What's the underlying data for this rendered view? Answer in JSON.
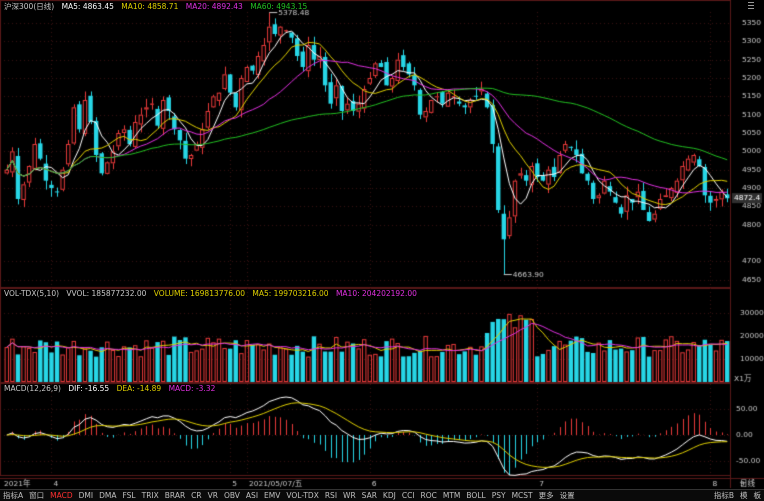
{
  "colors": {
    "up": "#e83a3a",
    "down": "#27d6e6",
    "ma5": "#ffffff",
    "ma10": "#e0d000",
    "ma20": "#e030e0",
    "ma60": "#22c022",
    "text": "#c8c8c8",
    "grid": "#3a1010",
    "axis": "#5a1818"
  },
  "price_info": {
    "name": "沪深300(日线)",
    "ma5": "MA5: 4863.45",
    "ma10": "MA10: 4858.71",
    "ma20": "MA20: 4892.43",
    "ma60": "MA60: 4943.15"
  },
  "volume_info": {
    "name": "VOL-TDX(5,10)",
    "vvol": "VVOL: 185877232.00",
    "volume": "VOLUME: 169813776.00",
    "ma5": "MA5: 199703216.00",
    "ma10": "MA10: 204202192.00"
  },
  "macd_info": {
    "name": "MACD(12,26,9)",
    "dif": "DIF: -16.55",
    "dea": "DEA: -14.89",
    "macd": "MACD: -3.32"
  },
  "chart_data": [
    {
      "type": "candlestick",
      "title": "沪深300(日线)",
      "y_ticks": [
        4650,
        4700,
        4800,
        4850,
        4900,
        4950,
        5000,
        5050,
        5100,
        5150,
        5200,
        5250,
        5300,
        5350
      ],
      "ylim": [
        4630,
        5380
      ],
      "annotations": [
        {
          "label": "5378.48",
          "value": 5378.48
        },
        {
          "label": "4663.90",
          "value": 4663.9
        }
      ],
      "current_price": "4872.4",
      "closes": [
        4950,
        5000,
        4870,
        4910,
        4960,
        5020,
        4980,
        4920,
        4900,
        4890,
        4950,
        5020,
        5120,
        5060,
        5140,
        5080,
        4990,
        4940,
        4970,
        5000,
        5050,
        5060,
        5020,
        5080,
        5100,
        5120,
        5130,
        5070,
        5140,
        5110,
        5060,
        5030,
        4980,
        4990,
        5020,
        5060,
        5110,
        5150,
        5160,
        5210,
        5160,
        5120,
        5200,
        5230,
        5220,
        5260,
        5290,
        5340,
        5320,
        5340,
        5330,
        5310,
        5260,
        5230,
        5290,
        5250,
        5260,
        5180,
        5130,
        5180,
        5110,
        5130,
        5110,
        5130,
        5170,
        5200,
        5240,
        5230,
        5180,
        5200,
        5250,
        5230,
        5210,
        5180,
        5100,
        5110,
        5140,
        5150,
        5130,
        5160,
        5150,
        5130,
        5120,
        5140,
        5150,
        5170,
        5120,
        5020,
        4840,
        4760,
        4820,
        4920,
        4940,
        4920,
        4960,
        4930,
        4920,
        4950,
        4930,
        4990,
        5020,
        5010,
        4990,
        4940,
        4920,
        4870,
        4880,
        4920,
        4890,
        4860,
        4830,
        4880,
        4860,
        4890,
        4840,
        4810,
        4830,
        4870,
        4880,
        4900,
        4920,
        4960,
        4980,
        4990,
        4960,
        4880,
        4860,
        4870,
        4890,
        4872
      ],
      "x_labels": [
        {
          "label": "2021年",
          "index": 0
        },
        {
          "label": "4",
          "index": 8
        },
        {
          "label": "5",
          "index": 40
        },
        {
          "label": "2021/05/07/五",
          "index": 43
        },
        {
          "label": "6",
          "index": 65
        },
        {
          "label": "7",
          "index": 95
        },
        {
          "label": "8",
          "index": 126
        },
        {
          "label": "9",
          "index": 158
        },
        {
          "label": "日线",
          "index": 185
        }
      ]
    },
    {
      "type": "bar",
      "title": "VOL-TDX(5,10)",
      "y_ticks": [
        10000,
        20000,
        30000
      ],
      "unit": "X1万",
      "ylim": [
        0,
        36000
      ]
    },
    {
      "type": "bar",
      "title": "MACD(12,26,9)",
      "y_ticks": [
        50,
        0,
        -50
      ],
      "ylim": [
        -78,
        80
      ]
    }
  ],
  "toolbar": {
    "items": [
      "指标A",
      "窗口",
      "MACD",
      "DMI",
      "DMA",
      "FSL",
      "TRIX",
      "BRAR",
      "CR",
      "VR",
      "OBV",
      "ASI",
      "EMV",
      "VOL-TDX",
      "RSI",
      "WR",
      "SAR",
      "KDJ",
      "CCI",
      "ROC",
      "MTM",
      "BOLL",
      "PSY",
      "MCST",
      "更多",
      "设置"
    ],
    "active": "MACD",
    "right_items": [
      "指标B",
      "模",
      "板"
    ]
  }
}
